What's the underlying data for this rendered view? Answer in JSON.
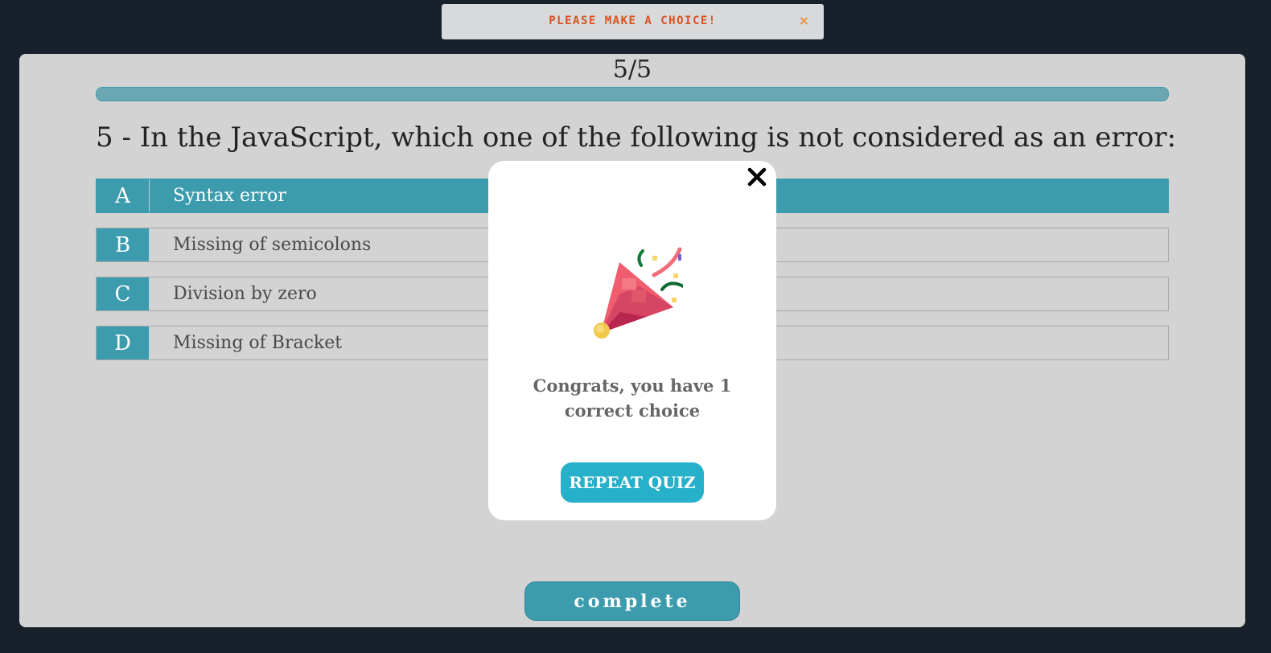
{
  "toast": {
    "message": "Please make a choice!",
    "close_glyph": "×"
  },
  "quiz": {
    "counter": "5/5",
    "progress_fraction": 1.0,
    "question": "5 - In the JavaScript, which one of the following is not considered as an error:",
    "options": [
      {
        "letter": "A",
        "text": "Syntax error",
        "selected": true
      },
      {
        "letter": "B",
        "text": "Missing of semicolons",
        "selected": false
      },
      {
        "letter": "C",
        "text": "Division by zero",
        "selected": false
      },
      {
        "letter": "D",
        "text": "Missing of Bracket",
        "selected": false
      }
    ],
    "complete_label": "complete"
  },
  "modal": {
    "icon": "party-popper-icon",
    "message": "Congrats, you have 1 correct choice",
    "repeat_label": "REPEAT QUIZ"
  },
  "colors": {
    "accent": "#3c9bad",
    "button": "#27b0c9",
    "toast_text": "#d9531e",
    "background": "#17202b",
    "card": "#d3d3d3"
  }
}
